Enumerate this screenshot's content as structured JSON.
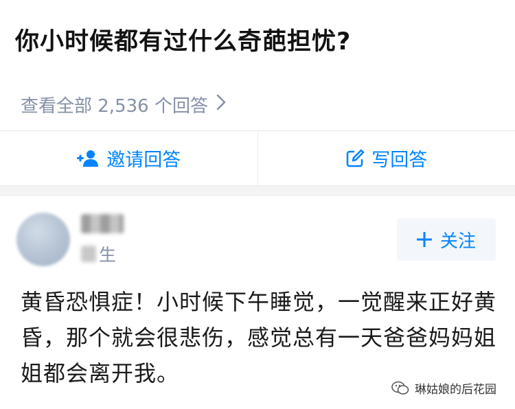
{
  "question": {
    "title": "你小时候都有过什么奇葩担忧?",
    "view_all_label": "查看全部 2,536 个回答"
  },
  "actions": {
    "invite_label": "邀请回答",
    "write_label": "写回答"
  },
  "author": {
    "desc_visible": "生"
  },
  "follow": {
    "label": "关注"
  },
  "answer": {
    "text": "黄昏恐惧症！小时候下午睡觉，一觉醒来正好黄昏，那个就会很悲伤，感觉总有一天爸爸妈妈姐姐都会离开我。"
  },
  "watermark": {
    "label": "琳姑娘的后花园"
  },
  "colors": {
    "accent": "#0084ff",
    "muted": "#8590a6",
    "divider": "#ebebeb"
  },
  "icons": {
    "invite": "add-person-icon",
    "write": "edit-icon",
    "view_all": "chevron-right-icon",
    "follow": "plus-icon",
    "watermark": "wechat-icon"
  }
}
